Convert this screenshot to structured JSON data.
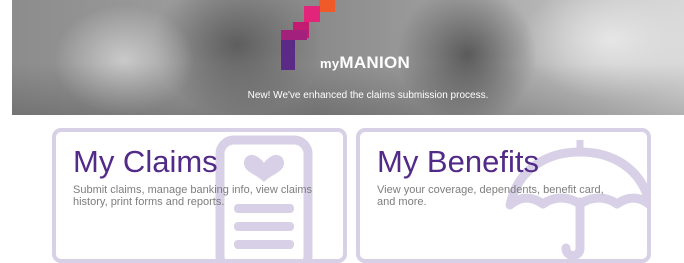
{
  "hero": {
    "logo_prefix": "my",
    "logo_name": "MANION",
    "message": "New! We've enhanced the claims submission process."
  },
  "cards": [
    {
      "title": "My Claims",
      "description": "Submit claims, manage banking info, view claims history, print forms and reports.",
      "icon": "document-heart-icon"
    },
    {
      "title": "My Benefits",
      "description": "View your coverage, dependents, benefit card, and more.",
      "icon": "umbrella-icon"
    }
  ],
  "colors": {
    "brand_purple": "#522a87",
    "card_border": "#d7d0e6",
    "logo_orange": "#f05a28",
    "logo_magenta": "#c31a72",
    "logo_purple": "#5b2a86"
  }
}
